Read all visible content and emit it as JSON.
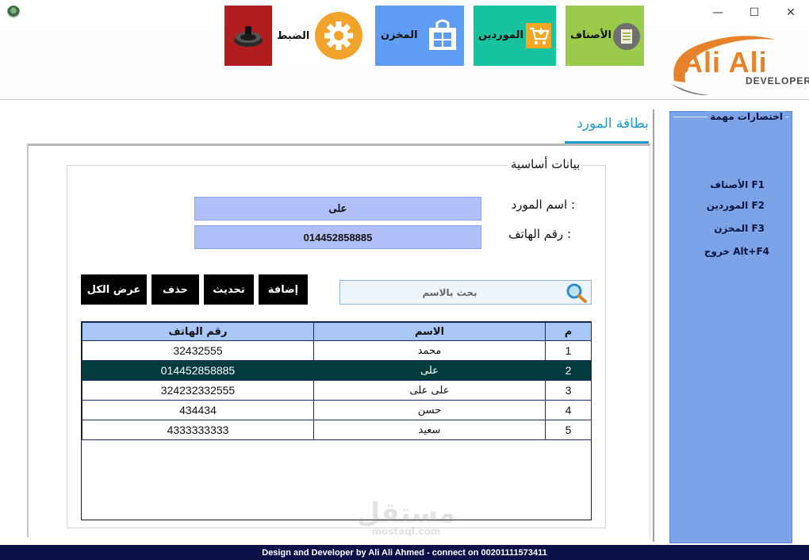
{
  "window": {
    "minimize": "—",
    "maximize": "☐",
    "close": "✕"
  },
  "toolbar": {
    "items": [
      {
        "label": "الضبط",
        "color": "#f2a32a",
        "icon": "gear-icon"
      },
      {
        "label": "المخزن",
        "color": "#5f9df4",
        "icon": "store-icon"
      },
      {
        "label": "الموردين",
        "color": "#17c29e",
        "icon": "cart-icon"
      },
      {
        "label": "الأصناف",
        "color": "#9bcb4a",
        "icon": "list-icon"
      }
    ],
    "power_color": "#b21d20"
  },
  "logo": {
    "title": "Ali Ali",
    "subtitle": "DEVELOPER"
  },
  "card": {
    "tab_title": "بطاقة المورد",
    "group_title": "بيانات أساسية",
    "name_label": "اسم المورد :",
    "phone_label": "رقم الهاتف :",
    "name_value": "على",
    "phone_value": "014452858885"
  },
  "actions": {
    "add": "إضافة",
    "update": "تحديث",
    "delete": "حذف",
    "show_all": "عرض الكل"
  },
  "search": {
    "placeholder": "بحث بالاسم"
  },
  "table": {
    "headers": {
      "index": "م",
      "name": "الاسم",
      "phone": "رقم الهاتف"
    },
    "rows": [
      {
        "index": "1",
        "name": "محمد",
        "phone": "32432555"
      },
      {
        "index": "2",
        "name": "على",
        "phone": "014452858885"
      },
      {
        "index": "3",
        "name": "على على",
        "phone": "324232332555"
      },
      {
        "index": "4",
        "name": "حسن",
        "phone": "434434"
      },
      {
        "index": "5",
        "name": "سعيد",
        "phone": "4333333333"
      }
    ],
    "selected_row": 1
  },
  "shortcuts": {
    "title": "اختصارات مهمة",
    "items": [
      "الأصناف  F1",
      "الموردين  F2",
      "المخزن F3",
      "خروج  Alt+F4"
    ]
  },
  "footer": {
    "text": "Design and Developer by Ali Ali Ahmed - connect on 00201111573411"
  },
  "watermark": {
    "line1": "مستقل",
    "line2": "mostaql.com"
  }
}
